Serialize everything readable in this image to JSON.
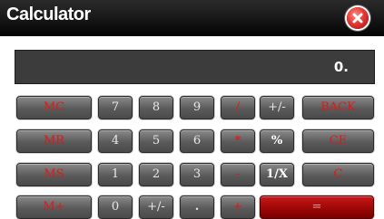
{
  "window": {
    "title": "Calculator"
  },
  "display": {
    "value": "0."
  },
  "buttons": {
    "mc": "MC",
    "mr": "MR",
    "ms": "MS",
    "mplus": "M+",
    "d7": "7",
    "d8": "8",
    "d9": "9",
    "d4": "4",
    "d5": "5",
    "d6": "6",
    "d1": "1",
    "d2": "2",
    "d3": "3",
    "d0": "0",
    "divide": "/",
    "multiply": "*",
    "subtract": "-",
    "add": "+",
    "sign_top": "+/-",
    "sign_bottom": "+/-",
    "percent": "%",
    "reciprocal": "1/X",
    "decimal": ".",
    "back": "BACK",
    "ce": "CE",
    "c": "C",
    "equals": "="
  },
  "colors": {
    "titlebar": "#050505",
    "display_bg": "#3c3c3c",
    "button_gray": "#5a5a5a",
    "operator_red": "#e01818",
    "equals_red": "#9a0606",
    "close_red": "#e53935"
  }
}
